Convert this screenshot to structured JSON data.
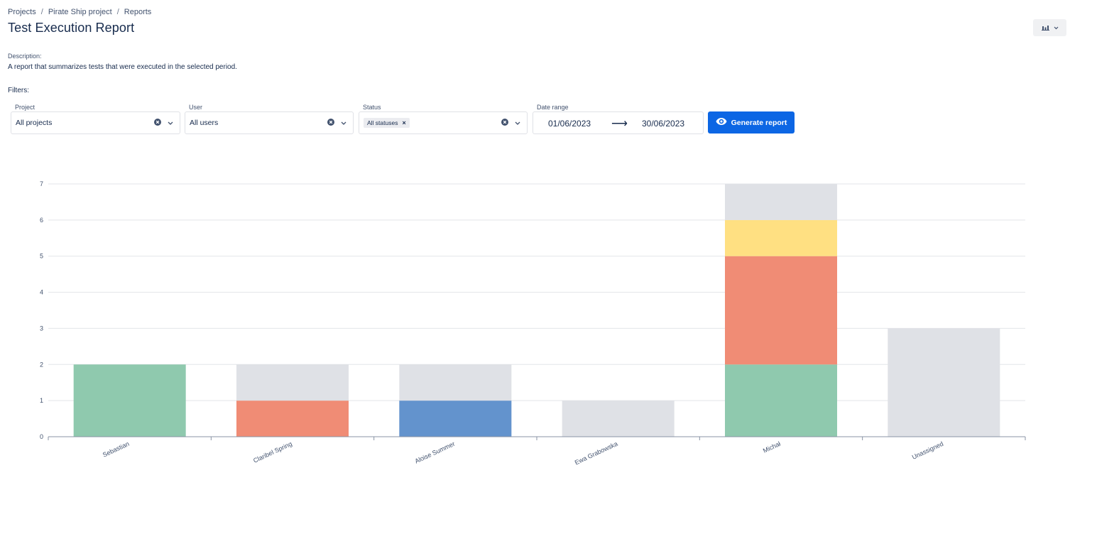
{
  "breadcrumb": {
    "items": [
      "Projects",
      "Pirate Ship project",
      "Reports"
    ],
    "separator": "/"
  },
  "page": {
    "title": "Test Execution Report",
    "description_label": "Description:",
    "description": "A report that summarizes tests that were executed in the selected period.",
    "filters_label": "Filters:"
  },
  "toolbar": {
    "chart_menu_icon": "bar-chart-icon"
  },
  "filters": {
    "project": {
      "label": "Project",
      "value": "All projects"
    },
    "user": {
      "label": "User",
      "value": "All users"
    },
    "status": {
      "label": "Status",
      "tag": "All statuses"
    },
    "date_range": {
      "label": "Date range",
      "from": "01/06/2023",
      "to": "30/06/2023",
      "arrow": "⟶"
    },
    "generate_label": "Generate report"
  },
  "colors": {
    "passed": "#8fc9ae",
    "failed": "#f08c75",
    "blocked": "#ffe082",
    "in_progress": "#6393cd",
    "not_executed": "#dfe1e6",
    "primary": "#0c66e4"
  },
  "chart_data": {
    "type": "bar",
    "stacked": true,
    "categories": [
      "Sebastian",
      "Claribel Spring",
      "Aloise Summer",
      "Ewa Grabowska",
      "Michał",
      "Unassigned"
    ],
    "series": [
      {
        "color": "#8fc9ae",
        "values": [
          2,
          0,
          0,
          0,
          2,
          0
        ]
      },
      {
        "color": "#f08c75",
        "values": [
          0,
          1,
          0,
          0,
          3,
          0
        ]
      },
      {
        "color": "#6393cd",
        "values": [
          0,
          0,
          1,
          0,
          0,
          0
        ]
      },
      {
        "color": "#ffe082",
        "values": [
          0,
          0,
          0,
          0,
          1,
          0
        ]
      },
      {
        "color": "#dfe1e6",
        "values": [
          0,
          1,
          1,
          1,
          1,
          3
        ]
      }
    ],
    "ylim": [
      0,
      7
    ],
    "yticks": [
      0,
      1,
      2,
      3,
      4,
      5,
      6,
      7
    ],
    "grid": true,
    "xlabel": "",
    "ylabel": ""
  }
}
